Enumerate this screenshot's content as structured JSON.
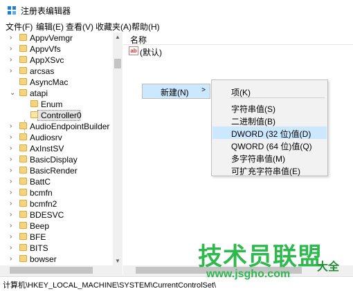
{
  "window": {
    "title": "注册表编辑器"
  },
  "menu": [
    "文件(F)",
    "编辑(E)",
    "查看(V)",
    "收藏夹(A)",
    "帮助(H)"
  ],
  "tree": {
    "items": [
      {
        "label": "AppvVemgr",
        "expander": "chevron-right"
      },
      {
        "label": "AppvVfs",
        "expander": "chevron-right"
      },
      {
        "label": "AppXSvc",
        "expander": "chevron-right"
      },
      {
        "label": "arcsas",
        "expander": "chevron-right"
      },
      {
        "label": "AsyncMac",
        "expander": "none"
      },
      {
        "label": "atapi",
        "expander": "chevron-down"
      },
      {
        "label": "Enum",
        "expander": "none",
        "child": true
      },
      {
        "label": "Controller0",
        "expander": "none",
        "child": true,
        "selected": true
      },
      {
        "label": "AudioEndpointBuilder",
        "expander": "chevron-right"
      },
      {
        "label": "Audiosrv",
        "expander": "chevron-right"
      },
      {
        "label": "AxInstSV",
        "expander": "chevron-right"
      },
      {
        "label": "BasicDisplay",
        "expander": "chevron-right"
      },
      {
        "label": "BasicRender",
        "expander": "chevron-right"
      },
      {
        "label": "BattC",
        "expander": "chevron-right"
      },
      {
        "label": "bcmfn",
        "expander": "chevron-right"
      },
      {
        "label": "bcmfn2",
        "expander": "chevron-right"
      },
      {
        "label": "BDESVC",
        "expander": "chevron-right"
      },
      {
        "label": "Beep",
        "expander": "chevron-right"
      },
      {
        "label": "BFE",
        "expander": "chevron-right"
      },
      {
        "label": "BITS",
        "expander": "chevron-right"
      },
      {
        "label": "bowser",
        "expander": "chevron-right"
      }
    ]
  },
  "list": {
    "header_name": "名称",
    "rows": [
      {
        "icon": "ab",
        "name": "(默认)"
      }
    ]
  },
  "context_menu": {
    "new_label": "新建(N)"
  },
  "submenu": {
    "items": [
      "项(K)",
      "字符串值(S)",
      "二进制值(B)",
      "DWORD (32 位)值(D)",
      "QWORD (64 位)值(Q)",
      "多字符串值(M)",
      "可扩充字符串值(E)"
    ],
    "highlighted_index": 3
  },
  "status": {
    "path": "计算机\\HKEY_LOCAL_MACHINE\\SYSTEM\\CurrentControlSet\\"
  },
  "watermark": {
    "title": "技术员联盟",
    "url": "www.jsgho.com",
    "side": "大全"
  },
  "colors": {
    "highlight": "#cce8ff",
    "folder": "#f7d37a",
    "watermark": "#2fb84e"
  }
}
